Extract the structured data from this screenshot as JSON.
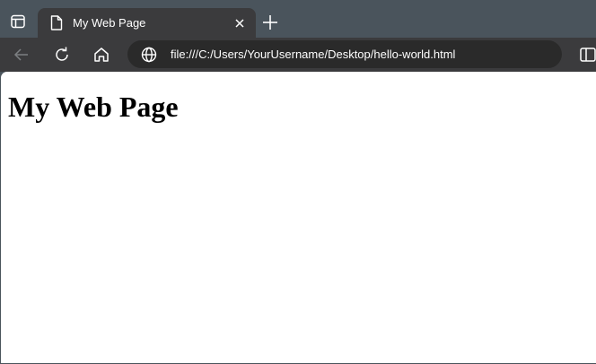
{
  "browser": {
    "tab": {
      "title": "My Web Page",
      "icon": "page-icon"
    },
    "toolbar": {
      "back_icon": "back-arrow-icon",
      "reload_icon": "reload-icon",
      "home_icon": "home-icon",
      "url": "file:///C:/Users/YourUsername/Desktop/hello-world.html",
      "url_icon": "globe-icon"
    },
    "colors": {
      "titlebar": "#4a545c",
      "active_tab": "#3b3b3d",
      "address_bar": "#2a2a2a",
      "page_background": "#ffffff"
    }
  },
  "page": {
    "heading": "My Web Page"
  }
}
